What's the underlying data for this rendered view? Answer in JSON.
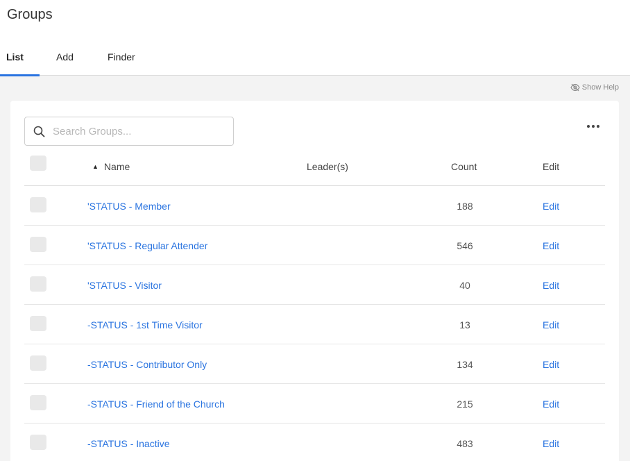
{
  "page": {
    "title": "Groups"
  },
  "tabs": [
    {
      "label": "List",
      "active": true
    },
    {
      "label": "Add",
      "active": false
    },
    {
      "label": "Finder",
      "active": false
    }
  ],
  "help": {
    "label": "Show Help"
  },
  "search": {
    "placeholder": "Search Groups...",
    "value": ""
  },
  "table": {
    "columns": {
      "name": "Name",
      "leaders": "Leader(s)",
      "count": "Count",
      "edit": "Edit"
    },
    "sort": {
      "column": "Name",
      "direction": "ascending"
    },
    "rows": [
      {
        "name": "'STATUS - Member",
        "leaders": "",
        "count": "188",
        "edit": "Edit"
      },
      {
        "name": "'STATUS - Regular Attender",
        "leaders": "",
        "count": "546",
        "edit": "Edit"
      },
      {
        "name": "'STATUS - Visitor",
        "leaders": "",
        "count": "40",
        "edit": "Edit"
      },
      {
        "name": "-STATUS - 1st Time Visitor",
        "leaders": "",
        "count": "13",
        "edit": "Edit"
      },
      {
        "name": "-STATUS - Contributor Only",
        "leaders": "",
        "count": "134",
        "edit": "Edit"
      },
      {
        "name": "-STATUS - Friend of the Church",
        "leaders": "",
        "count": "215",
        "edit": "Edit"
      },
      {
        "name": "-STATUS - Inactive",
        "leaders": "",
        "count": "483",
        "edit": "Edit"
      }
    ]
  },
  "colors": {
    "accent": "#2a74e0",
    "background": "#f3f3f3",
    "card": "#ffffff"
  }
}
